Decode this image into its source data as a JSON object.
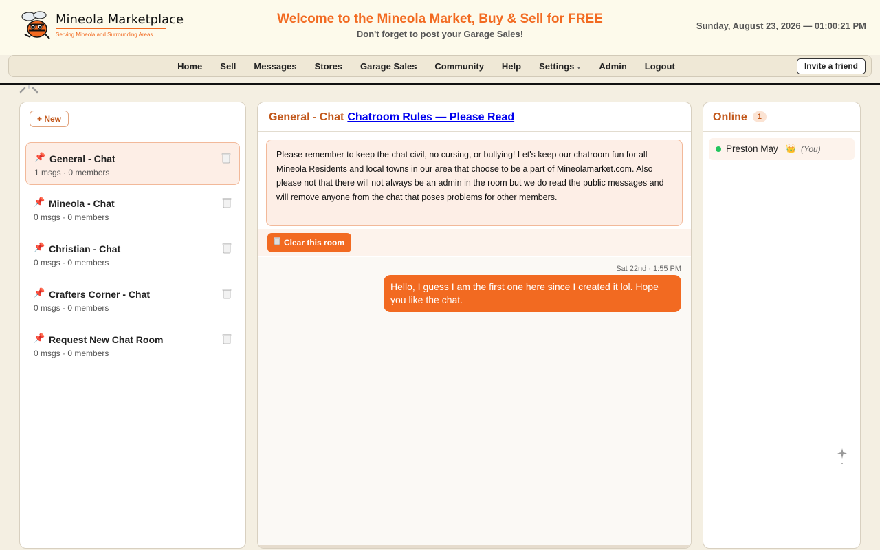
{
  "header": {
    "logo_title": "Mineola Marketplace",
    "logo_subtitle": "Serving Mineola and Surrounding Areas",
    "welcome": "Welcome to the Mineola Market, Buy & Sell for FREE",
    "subwelcome": "Don't forget to post your Garage Sales!",
    "datetime": "Sunday, August 23, 2026 — 01:00:21 PM"
  },
  "nav": {
    "items": [
      "Home",
      "Sell",
      "Messages",
      "Stores",
      "Garage Sales",
      "Community",
      "Help",
      "Settings",
      "Admin",
      "Logout"
    ],
    "invite_label": "Invite a friend"
  },
  "rooms_panel": {
    "new_label": "+ New",
    "rooms": [
      {
        "name": "General - Chat",
        "meta": "1 msgs · 0 members",
        "active": true
      },
      {
        "name": "Mineola - Chat",
        "meta": "0 msgs · 0 members",
        "active": false
      },
      {
        "name": "Christian - Chat",
        "meta": "0 msgs · 0 members",
        "active": false
      },
      {
        "name": "Crafters Corner - Chat",
        "meta": "0 msgs · 0 members",
        "active": false
      },
      {
        "name": "Request New Chat Room",
        "meta": "0 msgs · 0 members",
        "active": false
      }
    ]
  },
  "chat": {
    "room_title": "General - Chat",
    "rules_link": "Chatroom Rules — Please Read",
    "rules_text": "Please remember to keep the chat civil, no cursing, or bullying! Let's keep our chatroom fun for all Mineola Residents and local towns in our area that choose to be a part of Mineolamarket.com.  Also please not that there will not always be an admin in the room but we do read the public messages and will remove anyone from the chat that poses problems for other members.",
    "clear_label": "Clear this room",
    "messages": [
      {
        "time": "Sat 22nd · 1:55 PM",
        "text": "Hello, I guess I am the first one here since I created it lol. Hope you like the chat."
      }
    ]
  },
  "online": {
    "title": "Online",
    "count": "1",
    "users": [
      {
        "name": "Preston May",
        "you": "(You)"
      }
    ]
  },
  "colors": {
    "accent": "#f26a21",
    "heading": "#c2571a",
    "online_dot": "#22c55e"
  }
}
